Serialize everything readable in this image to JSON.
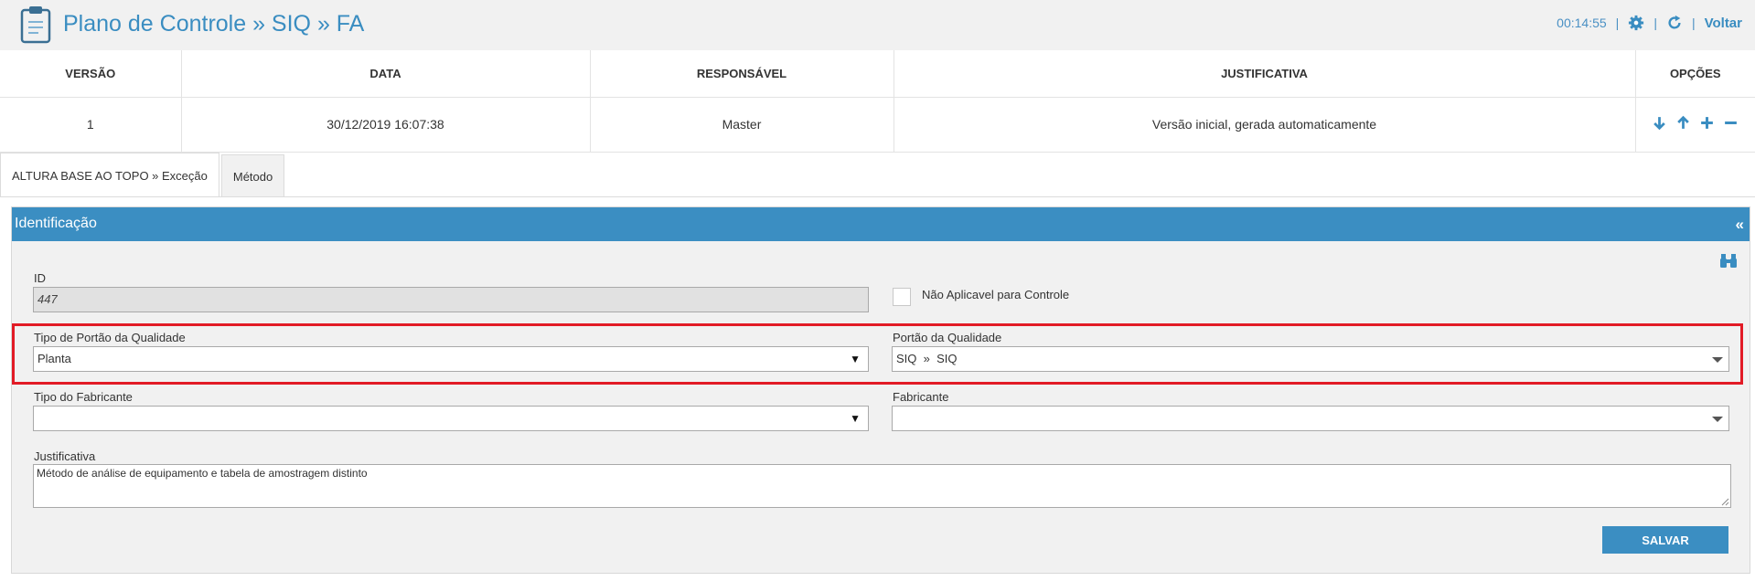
{
  "header": {
    "title": "Plano de Controle » SIQ » FA",
    "clock": "00:14:55",
    "back_label": "Voltar"
  },
  "versions_table": {
    "headers": [
      "VERSÃO",
      "DATA",
      "RESPONSÁVEL",
      "JUSTIFICATIVA",
      "OPÇÕES"
    ],
    "rows": [
      {
        "versao": "1",
        "data": "30/12/2019 16:07:38",
        "responsavel": "Master",
        "justificativa": "Versão inicial, gerada automaticamente"
      }
    ]
  },
  "tabs": [
    {
      "label": "ALTURA BASE AO TOPO » Exceção",
      "active": true
    },
    {
      "label": "Método",
      "active": false
    }
  ],
  "panel": {
    "title": "Identificação",
    "collapse_glyph": "«"
  },
  "form": {
    "id_label": "ID",
    "id_value": "447",
    "nao_aplicavel_label": "Não Aplicavel para Controle",
    "tipo_portao_label": "Tipo de Portão da Qualidade",
    "tipo_portao_value": "Planta",
    "portao_label": "Portão da Qualidade",
    "portao_value": "SIQ  »  SIQ",
    "tipo_fabricante_label": "Tipo do Fabricante",
    "tipo_fabricante_value": "",
    "fabricante_label": "Fabricante",
    "fabricante_value": "",
    "justificativa_label": "Justificativa",
    "justificativa_value": "Método de análise de equipamento e tabela de amostragem distinto",
    "save_label": "SALVAR"
  },
  "icons": {
    "app": "clipboard-icon",
    "settings": "gear-icon",
    "refresh": "refresh-icon",
    "options": [
      "arrow-down-icon",
      "arrow-up-icon",
      "plus-icon",
      "minus-icon"
    ],
    "search": "binoculars-icon"
  },
  "colors": {
    "accent": "#3b8ec2",
    "title": "#3a8dc1",
    "highlight": "#e21b26",
    "header_bg": "#f1f1f1"
  }
}
